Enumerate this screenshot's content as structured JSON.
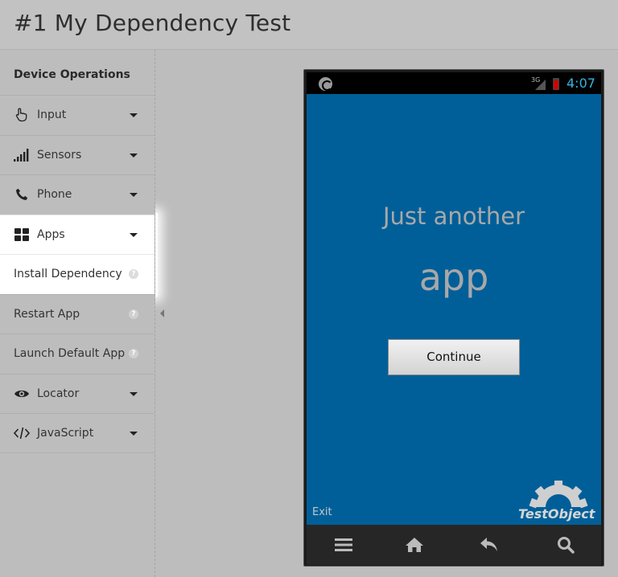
{
  "header": {
    "title": "#1 My Dependency Test"
  },
  "sidebar": {
    "heading": "Device Operations",
    "items": [
      {
        "label": "Input",
        "icon": "hand-pointer-icon"
      },
      {
        "label": "Sensors",
        "icon": "signal-bars-icon"
      },
      {
        "label": "Phone",
        "icon": "phone-icon"
      },
      {
        "label": "Apps",
        "icon": "grid-icon"
      },
      {
        "label": "Install Dependency",
        "help": "?"
      },
      {
        "label": "Restart App",
        "help": "?"
      },
      {
        "label": "Launch Default App",
        "help": "?"
      },
      {
        "label": "Locator",
        "icon": "eye-icon"
      },
      {
        "label": "JavaScript",
        "icon": "code-icon"
      }
    ]
  },
  "device": {
    "status_bar": {
      "network": "3G",
      "time": "4:07"
    },
    "screen": {
      "headline": "Just another",
      "app_word": "app",
      "button": "Continue",
      "exit": "Exit",
      "logo_text": "TestObject"
    }
  }
}
